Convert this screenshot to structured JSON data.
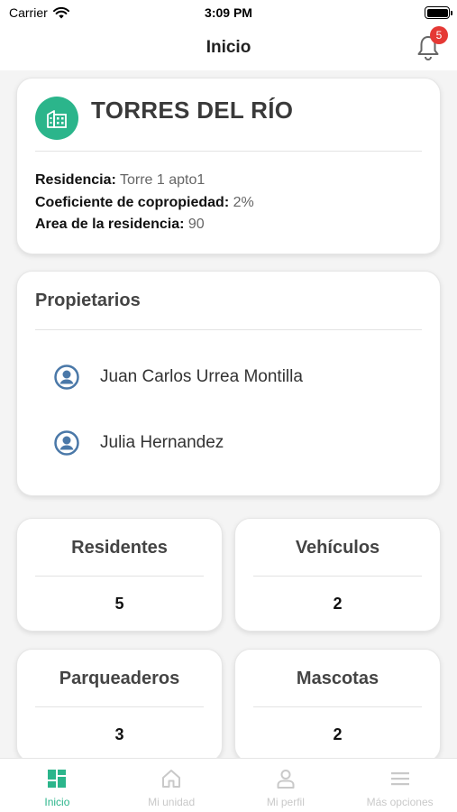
{
  "status_bar": {
    "carrier": "Carrier",
    "time": "3:09 PM"
  },
  "header": {
    "title": "Inicio",
    "notifications_count": "5"
  },
  "residence": {
    "title": "TORRES DEL RÍO",
    "residencia_label": "Residencia:",
    "residencia_value": "Torre 1 apto1",
    "coeficiente_label": "Coeficiente de copropiedad:",
    "coeficiente_value": "2%",
    "area_label": "Area de la residencia:",
    "area_value": "90"
  },
  "owners": {
    "title": "Propietarios",
    "items": [
      {
        "name": "Juan Carlos Urrea Montilla"
      },
      {
        "name": "Julia Hernandez"
      }
    ]
  },
  "stats": [
    {
      "label": "Residentes",
      "value": "5"
    },
    {
      "label": "Vehículos",
      "value": "2"
    },
    {
      "label": "Parqueaderos",
      "value": "3"
    },
    {
      "label": "Mascotas",
      "value": "2"
    }
  ],
  "tabs": [
    {
      "label": "Inicio",
      "icon": "dashboard-icon",
      "active": true
    },
    {
      "label": "Mi unidad",
      "icon": "home-icon",
      "active": false
    },
    {
      "label": "Mi perfil",
      "icon": "person-icon",
      "active": false
    },
    {
      "label": "Más opciones",
      "icon": "menu-icon",
      "active": false
    }
  ],
  "colors": {
    "accent": "#2bb58b",
    "badge": "#e53935",
    "owner_icon": "#4a78a8"
  }
}
